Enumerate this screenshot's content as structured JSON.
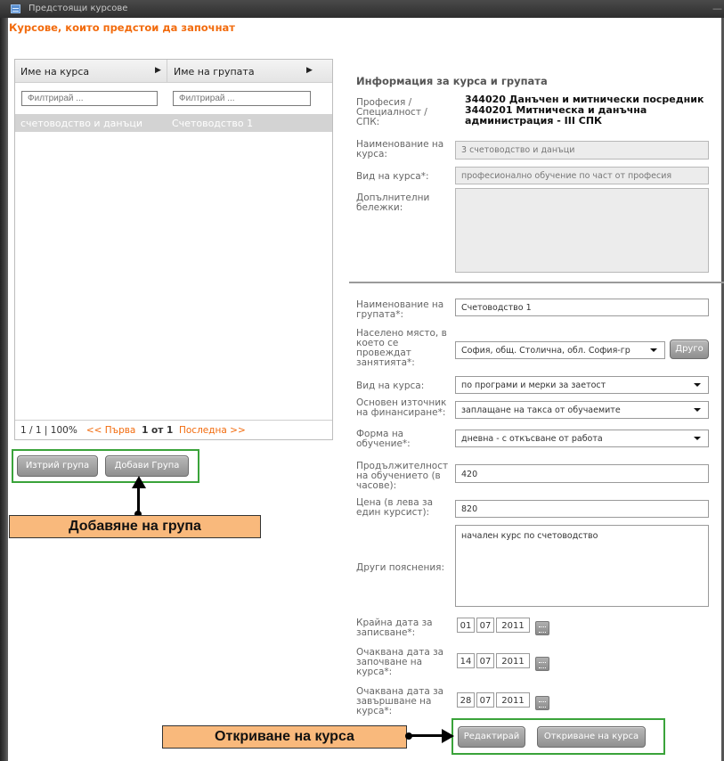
{
  "window": {
    "title": "Предстоящи курсове",
    "minimize": "—"
  },
  "section_title": "Курсове, които предстои да започнат",
  "grid": {
    "columns": [
      "Име на курса",
      "Име на групата"
    ],
    "filter_placeholders": [
      "Филтрирай ...",
      "Филтрирай ..."
    ],
    "rows": [
      {
        "course": "счетоводство и данъци",
        "group": "Счетоводство 1"
      }
    ],
    "pager": {
      "summary": "1 / 1 | 100%",
      "first": "<< Първа",
      "page": "1 от 1",
      "last": "Последна >>"
    }
  },
  "buttons": {
    "delete_group": "Изтрий група",
    "add_group": "Добави Група",
    "edit": "Редактирай",
    "open_course": "Откриване на курса",
    "other": "Друго"
  },
  "callouts": {
    "add_group": "Добавяне на група",
    "open_course": "Откриване на курса"
  },
  "info": {
    "title": "Информация за курса и групата",
    "profession_label": "Професия / Специалност / СПК:",
    "profession_value": "344020 Данъчен и митнически посредник 3440201 Митническа и данъчна администрация - III СПК",
    "course_name_label": "Наименование на курса:",
    "course_name_value": "3 счетоводство и данъци",
    "course_type_label": "Вид на курса*:",
    "course_type_value": "професионално обучение по част от професия",
    "notes_label": "Допълнителни бележки:",
    "group_name_label": "Наименование на групата*:",
    "group_name_value": "Счетоводство 1",
    "place_label": "Населено място, в което се провеждат занятията*:",
    "place_value": "София, общ. Столична, обл. София-гр",
    "course_kind_label": "Вид на курса:",
    "course_kind_value": "по програми и мерки за заетост",
    "funding_label": "Основен източник на финансиране*:",
    "funding_value": "заплащане на такса от обучаемите",
    "form_label": "Форма на обучение*:",
    "form_value": "дневна - с откъсване от работа",
    "duration_label": "Продължителност на обучението (в часове):",
    "duration_value": "420",
    "price_label": "Цена (в лева за един курсист):",
    "price_value": "820",
    "other_label": "Други пояснения:",
    "other_value": "начален курс по счетоводство",
    "enroll_end_label": "Крайна дата за записване*:",
    "enroll_end": {
      "d": "01",
      "m": "07",
      "y": "2011"
    },
    "start_label": "Очаквана дата за започване на курса*:",
    "start": {
      "d": "14",
      "m": "07",
      "y": "2011"
    },
    "end_label": "Очаквана дата за завършване на курса*:",
    "end": {
      "d": "28",
      "m": "07",
      "y": "2011"
    }
  },
  "colors": {
    "accent": "#f26b0d",
    "callout": "#f9b97c",
    "highlight_box": "#3aa33a"
  }
}
